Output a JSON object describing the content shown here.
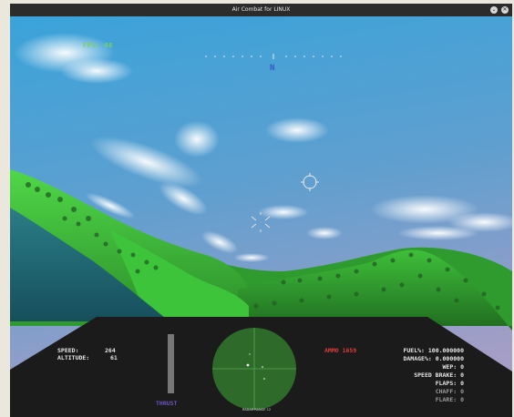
{
  "window": {
    "title": "Air Combat for LINUX",
    "minimize_glyph": "⌄",
    "close_glyph": "✕"
  },
  "hud": {
    "fps_text": "FPS: 66",
    "heading_letter": "N"
  },
  "cockpit": {
    "speed_label": "SPEED:",
    "speed_value": "264",
    "altitude_label": "ALTITUDE:",
    "altitude_value": "61",
    "thrust_label": "THRUST",
    "thrust_level": 0.0,
    "radar_range_text": "RADAR RANGE 12",
    "ammo_text": "AMMO 1659",
    "fuel_text": "FUEL%: 100.000000",
    "damage_text": "DAMAGE%: 0.000000",
    "wep_text": "WEP: 0",
    "speed_brake_text": "SPEED BRAKE: 0",
    "flaps_text": "FLAPS: 0",
    "chaff_text": "CHAFF: 0",
    "flare_text": "FLARE: 0"
  },
  "colors": {
    "sky_top": "#3f9fd4",
    "sky_horizon": "#9a9fc8",
    "terrain": "#3fbf3a",
    "water": "#1f6a78",
    "cockpit": "#1b1b1b",
    "radar": "#2e6a2a",
    "ammo": "#e23a3a",
    "thrust_label": "#6e52c0",
    "hud_green": "#78d25a",
    "compass_blue": "#3a56c6"
  }
}
